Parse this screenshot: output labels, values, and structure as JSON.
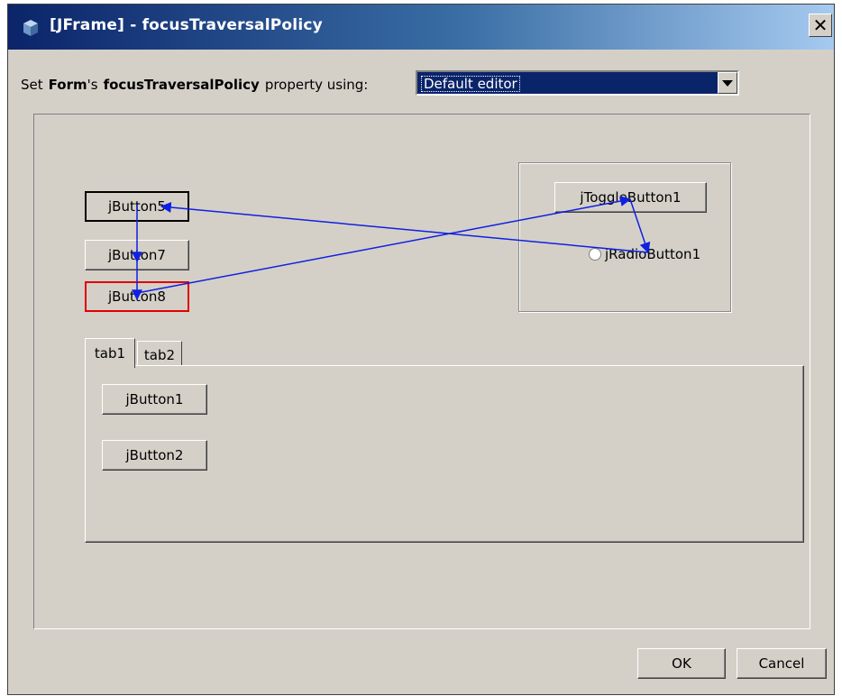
{
  "window": {
    "title": "[JFrame] - focusTraversalPolicy",
    "close_label": "✕"
  },
  "property_row": {
    "prefix": "Set",
    "form_name": "Form",
    "possessive": "'s",
    "property_name": "focusTraversalPolicy",
    "suffix": "property using:",
    "selected_option": "Default editor"
  },
  "form_buttons": {
    "button5": "jButton5",
    "button7": "jButton7",
    "button8": "jButton8",
    "toggle1": "jToggleButton1",
    "radio1": "jRadioButton1"
  },
  "tabs": [
    {
      "label": "tab1",
      "selected": true
    },
    {
      "label": "tab2",
      "selected": false
    }
  ],
  "tab_buttons": {
    "button1": "jButton1",
    "button2": "jButton2"
  },
  "footer": {
    "ok": "OK",
    "cancel": "Cancel"
  },
  "colors": {
    "arrow": "#1020e0",
    "focus_start": "#000000",
    "focus_end": "#e00000"
  }
}
